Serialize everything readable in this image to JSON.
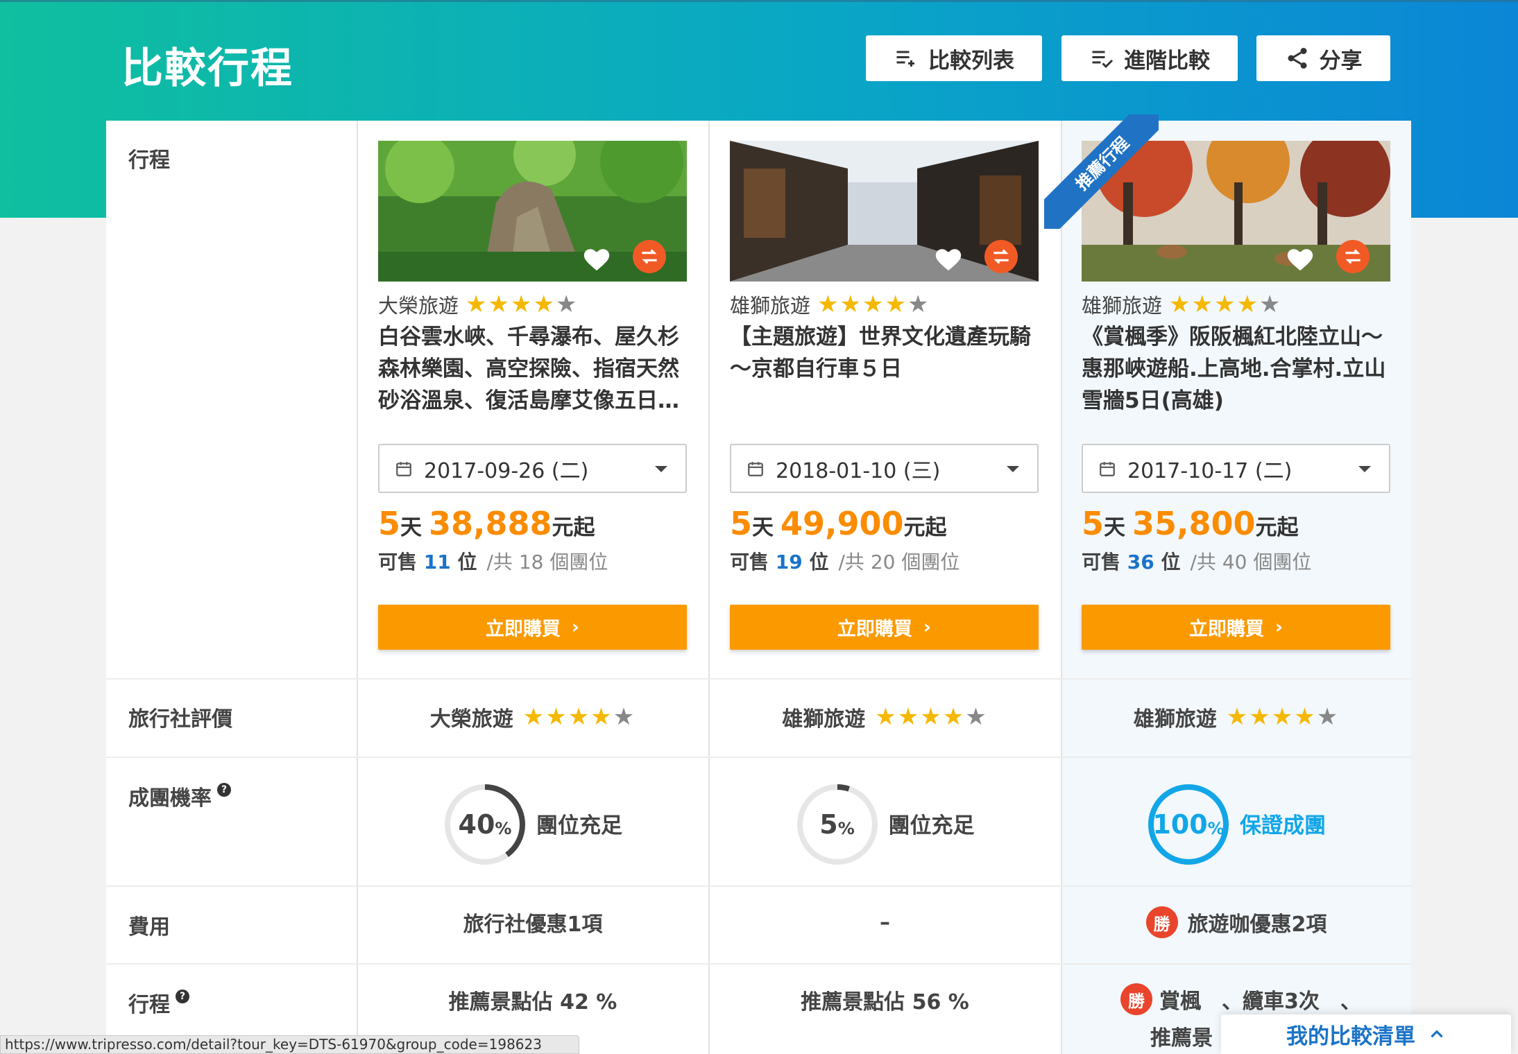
{
  "header": {
    "title": "比較行程",
    "buttons": {
      "compare_list": "比較列表",
      "advanced": "進階比較",
      "share": "分享"
    }
  },
  "rows": {
    "itinerary": "行程",
    "agency_rating": "旅行社評價",
    "group_prob": "成團機率",
    "cost": "費用",
    "itinerary2": "行程",
    "help_glyph": "?"
  },
  "ribbon": "推薦行程",
  "tours": [
    {
      "agency": "大榮旅遊",
      "stars": 4,
      "name": "白谷雲水峽、千尋瀑布、屋久杉森林樂園、高空探險、指宿天然砂浴溫泉、復活島摩艾像五日…",
      "date": "2017-09-26 (二)",
      "days": "5",
      "day_unit": "天",
      "price": "38,888",
      "price_unit": "元起",
      "seats_prefix": "可售",
      "seats_avail": "11",
      "seats_unit": "位",
      "seats_total": "/共 18 個團位",
      "buy": "立即購買",
      "probability": 40,
      "prob_text": "40",
      "pct_sign": "%",
      "prob_label": "團位充足",
      "cost": "旅行社優惠1項",
      "itinerary_info": "推薦景點佔 42 %"
    },
    {
      "agency": "雄獅旅遊",
      "stars": 4,
      "name": "【主題旅遊】世界文化遺產玩騎～京都自行車５日",
      "date": "2018-01-10 (三)",
      "days": "5",
      "day_unit": "天",
      "price": "49,900",
      "price_unit": "元起",
      "seats_prefix": "可售",
      "seats_avail": "19",
      "seats_unit": "位",
      "seats_total": "/共 20 個團位",
      "buy": "立即購買",
      "probability": 5,
      "prob_text": "5",
      "pct_sign": "%",
      "prob_label": "團位充足",
      "cost": "–",
      "itinerary_info": "推薦景點佔 56 %"
    },
    {
      "agency": "雄獅旅遊",
      "stars": 4,
      "name": "《賞楓季》阪阪楓紅北陸立山～惠那峽遊船.上高地.合掌村.立山雪牆5日(高雄)",
      "date": "2017-10-17 (二)",
      "days": "5",
      "day_unit": "天",
      "price": "35,800",
      "price_unit": "元起",
      "seats_prefix": "可售",
      "seats_avail": "36",
      "seats_unit": "位",
      "seats_total": "/共 40 個團位",
      "buy": "立即購買",
      "probability": 100,
      "prob_text": "100",
      "pct_sign": "%",
      "prob_label": "保證成團",
      "cost_badge": "勝",
      "cost": "旅遊咖優惠2項",
      "itinerary_badge": "勝",
      "itinerary_line1": "賞楓　、纜車3次　、",
      "itinerary_line2": "推薦景"
    }
  ],
  "statusbar": "https://www.tripresso.com/detail?tour_key=DTS-61970&group_code=198623",
  "compare_tab": "我的比較清單",
  "colors": {
    "orange": "#fb8c00",
    "buy_button": "#fb9a00",
    "blue": "#1a73c8",
    "ring_guarantee": "#11a6e8",
    "win_badge": "#e8452c"
  }
}
